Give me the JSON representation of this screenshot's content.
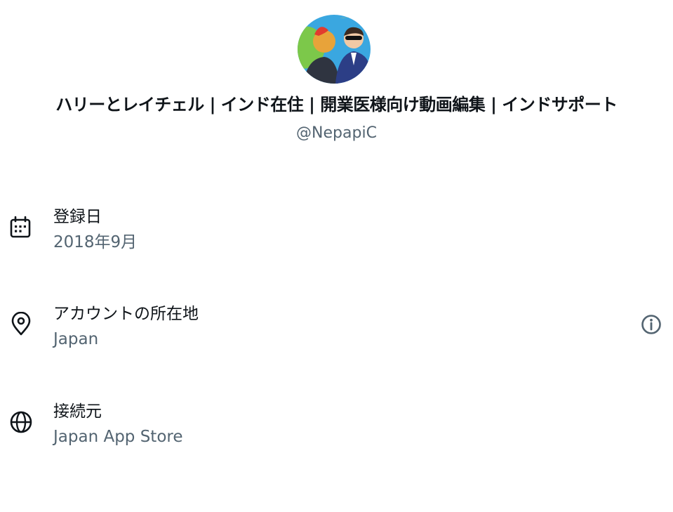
{
  "profile": {
    "display_name": "ハリーとレイチェル | インド在住 | 開業医様向け動画編集 | インドサポート",
    "handle": "@NepapiC"
  },
  "about": {
    "joined": {
      "icon": "calendar-icon",
      "title": "登録日",
      "value": "2018年9月"
    },
    "location": {
      "icon": "location-pin-icon",
      "title": "アカウントの所在地",
      "value": "Japan",
      "info_icon": "info-icon"
    },
    "connected_via": {
      "icon": "globe-icon",
      "title": "接続元",
      "value": "Japan App Store"
    }
  },
  "colors": {
    "primary_text": "#0f1419",
    "secondary_text": "#536471",
    "background": "#ffffff"
  }
}
